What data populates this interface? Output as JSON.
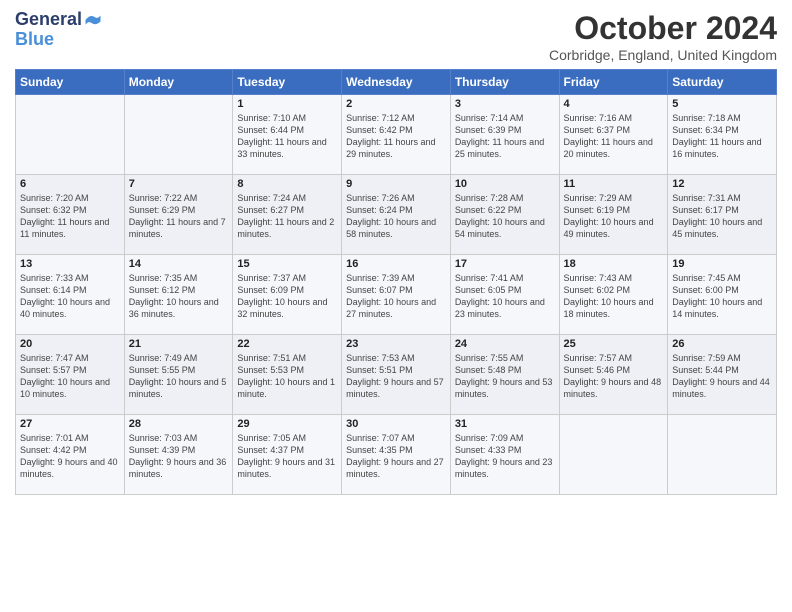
{
  "header": {
    "logo_line1": "General",
    "logo_line2": "Blue",
    "month_title": "October 2024",
    "location": "Corbridge, England, United Kingdom"
  },
  "days_of_week": [
    "Sunday",
    "Monday",
    "Tuesday",
    "Wednesday",
    "Thursday",
    "Friday",
    "Saturday"
  ],
  "weeks": [
    [
      {
        "day": "",
        "sunrise": "",
        "sunset": "",
        "daylight": ""
      },
      {
        "day": "",
        "sunrise": "",
        "sunset": "",
        "daylight": ""
      },
      {
        "day": "1",
        "sunrise": "Sunrise: 7:10 AM",
        "sunset": "Sunset: 6:44 PM",
        "daylight": "Daylight: 11 hours and 33 minutes."
      },
      {
        "day": "2",
        "sunrise": "Sunrise: 7:12 AM",
        "sunset": "Sunset: 6:42 PM",
        "daylight": "Daylight: 11 hours and 29 minutes."
      },
      {
        "day": "3",
        "sunrise": "Sunrise: 7:14 AM",
        "sunset": "Sunset: 6:39 PM",
        "daylight": "Daylight: 11 hours and 25 minutes."
      },
      {
        "day": "4",
        "sunrise": "Sunrise: 7:16 AM",
        "sunset": "Sunset: 6:37 PM",
        "daylight": "Daylight: 11 hours and 20 minutes."
      },
      {
        "day": "5",
        "sunrise": "Sunrise: 7:18 AM",
        "sunset": "Sunset: 6:34 PM",
        "daylight": "Daylight: 11 hours and 16 minutes."
      }
    ],
    [
      {
        "day": "6",
        "sunrise": "Sunrise: 7:20 AM",
        "sunset": "Sunset: 6:32 PM",
        "daylight": "Daylight: 11 hours and 11 minutes."
      },
      {
        "day": "7",
        "sunrise": "Sunrise: 7:22 AM",
        "sunset": "Sunset: 6:29 PM",
        "daylight": "Daylight: 11 hours and 7 minutes."
      },
      {
        "day": "8",
        "sunrise": "Sunrise: 7:24 AM",
        "sunset": "Sunset: 6:27 PM",
        "daylight": "Daylight: 11 hours and 2 minutes."
      },
      {
        "day": "9",
        "sunrise": "Sunrise: 7:26 AM",
        "sunset": "Sunset: 6:24 PM",
        "daylight": "Daylight: 10 hours and 58 minutes."
      },
      {
        "day": "10",
        "sunrise": "Sunrise: 7:28 AM",
        "sunset": "Sunset: 6:22 PM",
        "daylight": "Daylight: 10 hours and 54 minutes."
      },
      {
        "day": "11",
        "sunrise": "Sunrise: 7:29 AM",
        "sunset": "Sunset: 6:19 PM",
        "daylight": "Daylight: 10 hours and 49 minutes."
      },
      {
        "day": "12",
        "sunrise": "Sunrise: 7:31 AM",
        "sunset": "Sunset: 6:17 PM",
        "daylight": "Daylight: 10 hours and 45 minutes."
      }
    ],
    [
      {
        "day": "13",
        "sunrise": "Sunrise: 7:33 AM",
        "sunset": "Sunset: 6:14 PM",
        "daylight": "Daylight: 10 hours and 40 minutes."
      },
      {
        "day": "14",
        "sunrise": "Sunrise: 7:35 AM",
        "sunset": "Sunset: 6:12 PM",
        "daylight": "Daylight: 10 hours and 36 minutes."
      },
      {
        "day": "15",
        "sunrise": "Sunrise: 7:37 AM",
        "sunset": "Sunset: 6:09 PM",
        "daylight": "Daylight: 10 hours and 32 minutes."
      },
      {
        "day": "16",
        "sunrise": "Sunrise: 7:39 AM",
        "sunset": "Sunset: 6:07 PM",
        "daylight": "Daylight: 10 hours and 27 minutes."
      },
      {
        "day": "17",
        "sunrise": "Sunrise: 7:41 AM",
        "sunset": "Sunset: 6:05 PM",
        "daylight": "Daylight: 10 hours and 23 minutes."
      },
      {
        "day": "18",
        "sunrise": "Sunrise: 7:43 AM",
        "sunset": "Sunset: 6:02 PM",
        "daylight": "Daylight: 10 hours and 18 minutes."
      },
      {
        "day": "19",
        "sunrise": "Sunrise: 7:45 AM",
        "sunset": "Sunset: 6:00 PM",
        "daylight": "Daylight: 10 hours and 14 minutes."
      }
    ],
    [
      {
        "day": "20",
        "sunrise": "Sunrise: 7:47 AM",
        "sunset": "Sunset: 5:57 PM",
        "daylight": "Daylight: 10 hours and 10 minutes."
      },
      {
        "day": "21",
        "sunrise": "Sunrise: 7:49 AM",
        "sunset": "Sunset: 5:55 PM",
        "daylight": "Daylight: 10 hours and 5 minutes."
      },
      {
        "day": "22",
        "sunrise": "Sunrise: 7:51 AM",
        "sunset": "Sunset: 5:53 PM",
        "daylight": "Daylight: 10 hours and 1 minute."
      },
      {
        "day": "23",
        "sunrise": "Sunrise: 7:53 AM",
        "sunset": "Sunset: 5:51 PM",
        "daylight": "Daylight: 9 hours and 57 minutes."
      },
      {
        "day": "24",
        "sunrise": "Sunrise: 7:55 AM",
        "sunset": "Sunset: 5:48 PM",
        "daylight": "Daylight: 9 hours and 53 minutes."
      },
      {
        "day": "25",
        "sunrise": "Sunrise: 7:57 AM",
        "sunset": "Sunset: 5:46 PM",
        "daylight": "Daylight: 9 hours and 48 minutes."
      },
      {
        "day": "26",
        "sunrise": "Sunrise: 7:59 AM",
        "sunset": "Sunset: 5:44 PM",
        "daylight": "Daylight: 9 hours and 44 minutes."
      }
    ],
    [
      {
        "day": "27",
        "sunrise": "Sunrise: 7:01 AM",
        "sunset": "Sunset: 4:42 PM",
        "daylight": "Daylight: 9 hours and 40 minutes."
      },
      {
        "day": "28",
        "sunrise": "Sunrise: 7:03 AM",
        "sunset": "Sunset: 4:39 PM",
        "daylight": "Daylight: 9 hours and 36 minutes."
      },
      {
        "day": "29",
        "sunrise": "Sunrise: 7:05 AM",
        "sunset": "Sunset: 4:37 PM",
        "daylight": "Daylight: 9 hours and 31 minutes."
      },
      {
        "day": "30",
        "sunrise": "Sunrise: 7:07 AM",
        "sunset": "Sunset: 4:35 PM",
        "daylight": "Daylight: 9 hours and 27 minutes."
      },
      {
        "day": "31",
        "sunrise": "Sunrise: 7:09 AM",
        "sunset": "Sunset: 4:33 PM",
        "daylight": "Daylight: 9 hours and 23 minutes."
      },
      {
        "day": "",
        "sunrise": "",
        "sunset": "",
        "daylight": ""
      },
      {
        "day": "",
        "sunrise": "",
        "sunset": "",
        "daylight": ""
      }
    ]
  ]
}
